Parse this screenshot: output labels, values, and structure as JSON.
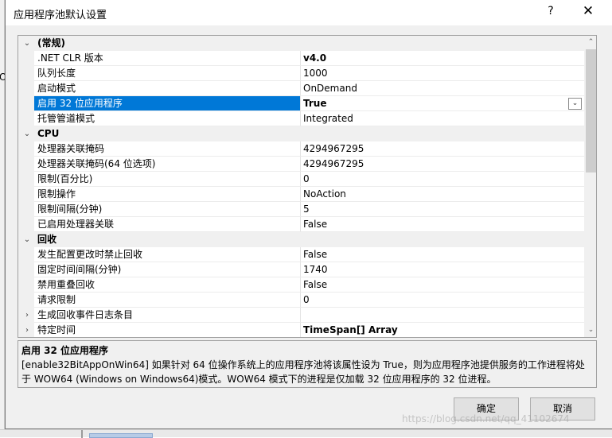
{
  "dialog": {
    "title": "应用程序池默认设置",
    "help_glyph": "?",
    "close_glyph": "✕"
  },
  "background": {
    "left_fragment": "O"
  },
  "grid": {
    "rows": [
      {
        "type": "category",
        "label": "(常规)",
        "expanded": true
      },
      {
        "type": "property",
        "name": ".NET CLR 版本",
        "value": "v4.0",
        "bold": true
      },
      {
        "type": "property",
        "name": "队列长度",
        "value": "1000"
      },
      {
        "type": "property",
        "name": "启动模式",
        "value": "OnDemand"
      },
      {
        "type": "property",
        "name": "启用 32 位应用程序",
        "value": "True",
        "bold": true,
        "selected": true,
        "dropdown": true
      },
      {
        "type": "property",
        "name": "托管管道模式",
        "value": "Integrated"
      },
      {
        "type": "category",
        "label": "CPU",
        "expanded": true
      },
      {
        "type": "property",
        "name": "处理器关联掩码",
        "value": "4294967295"
      },
      {
        "type": "property",
        "name": "处理器关联掩码(64 位选项)",
        "value": "4294967295"
      },
      {
        "type": "property",
        "name": "限制(百分比)",
        "value": "0"
      },
      {
        "type": "property",
        "name": "限制操作",
        "value": "NoAction"
      },
      {
        "type": "property",
        "name": "限制间隔(分钟)",
        "value": "5"
      },
      {
        "type": "property",
        "name": "已启用处理器关联",
        "value": "False"
      },
      {
        "type": "category",
        "label": "回收",
        "expanded": true
      },
      {
        "type": "property",
        "name": "发生配置更改时禁止回收",
        "value": "False"
      },
      {
        "type": "property",
        "name": "固定时间间隔(分钟)",
        "value": "1740"
      },
      {
        "type": "property",
        "name": "禁用重叠回收",
        "value": "False"
      },
      {
        "type": "property",
        "name": "请求限制",
        "value": "0"
      },
      {
        "type": "property",
        "name": "生成回收事件日志条目",
        "value": "",
        "expandable": true
      },
      {
        "type": "property",
        "name": "特定时间",
        "value": "TimeSpan[] Array",
        "bold": true,
        "expandable": true
      }
    ],
    "dropdown_glyph": "⌄",
    "collapse_glyph": "⌄",
    "expand_glyph": "›",
    "scroll_up_glyph": "⌃",
    "scroll_down_glyph": "⌄",
    "scroll": {
      "thumb_position_fraction": 0.0,
      "visible_fraction": 0.45
    }
  },
  "description": {
    "title": "启用 32 位应用程序",
    "text": "[enable32BitAppOnWin64] 如果针对 64 位操作系统上的应用程序池将该属性设为 True，则为应用程序池提供服务的工作进程将处于 WOW64 (Windows on Windows64)模式。WOW64 模式下的进程是仅加载 32 位应用程序的 32 位进程。"
  },
  "buttons": {
    "ok": "确定",
    "cancel": "取消"
  },
  "watermark": "https://blog.csdn.net/qq_41102674"
}
